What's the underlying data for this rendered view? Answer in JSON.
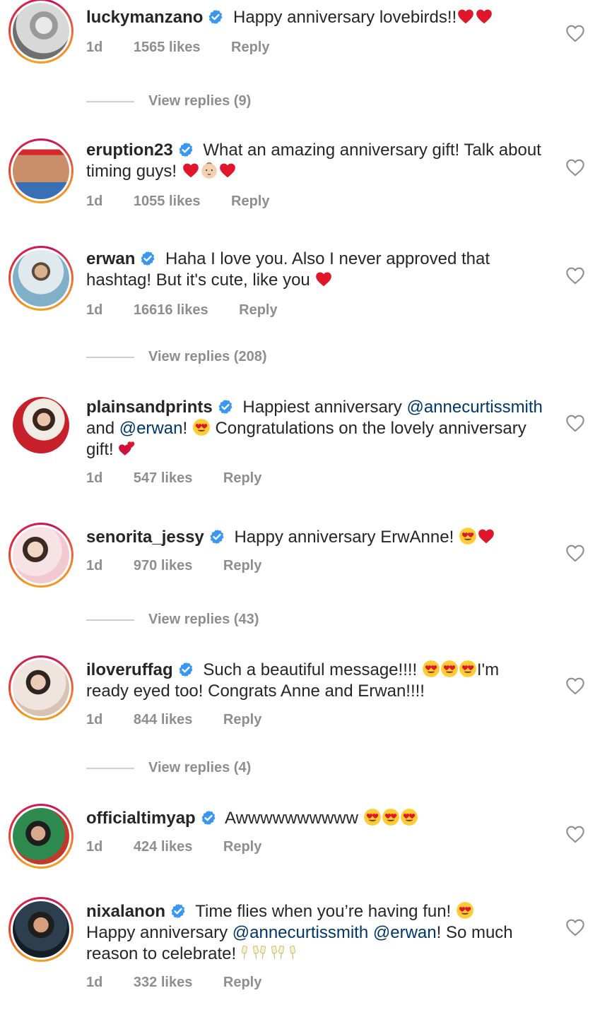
{
  "comments": [
    {
      "username": "luckymanzano",
      "text": " Happy anniversary lovebirds!!",
      "time": "1d",
      "likes": "1565 likes",
      "reply": "Reply",
      "view_replies": "View replies (9)"
    },
    {
      "username": "eruption23",
      "text": " What an amazing anniversary gift! Talk about timing guys! ",
      "time": "1d",
      "likes": "1055 likes",
      "reply": "Reply"
    },
    {
      "username": "erwan",
      "text": " Haha I love you. Also I never approved that hashtag! But it's cute, like you ",
      "time": "1d",
      "likes": "16616 likes",
      "reply": "Reply",
      "view_replies": "View replies (208)"
    },
    {
      "username": "plainsandprints",
      "text_a": " Happiest anniversary ",
      "mention1": "@annecurtissmith",
      "text_b": " and ",
      "mention2": "@erwan",
      "text_c": "! ",
      "text_d": " Congratulations on the lovely anniversary gift! ",
      "time": "1d",
      "likes": "547 likes",
      "reply": "Reply"
    },
    {
      "username": "senorita_jessy",
      "text": " Happy anniversary ErwAnne! ",
      "time": "1d",
      "likes": "970 likes",
      "reply": "Reply",
      "view_replies": "View replies (43)"
    },
    {
      "username": "iloveruffag",
      "text_a": " Such a beautiful message!!!! ",
      "text_b": "I'm ready eyed too! Congrats Anne and Erwan!!!!",
      "time": "1d",
      "likes": "844 likes",
      "reply": "Reply",
      "view_replies": "View replies (4)"
    },
    {
      "username": "officialtimyap",
      "text": " Awwwwwwwwww ",
      "time": "1d",
      "likes": "424 likes",
      "reply": "Reply"
    },
    {
      "username": "nixalanon",
      "text_a": " Time flies when you’re having fun! ",
      "text_b": "Happy anniversary ",
      "mention1": "@annecurtissmith",
      "text_c": " ",
      "mention2": "@erwan",
      "text_d": "! So much reason to celebrate! ",
      "time": "1d",
      "likes": "332 likes",
      "reply": "Reply"
    }
  ],
  "colors": {
    "text": "#262626",
    "meta": "#8e8e8e",
    "mention": "#00376b",
    "verified": "#3897f0",
    "heart": "#e0162b"
  },
  "icons": {
    "verified": "verified-badge-icon",
    "like": "heart-outline-icon",
    "emoji_heart": "red-heart-emoji",
    "emoji_eyes": "heart-eyes-emoji",
    "emoji_baby": "baby-emoji",
    "emoji_hearts": "two-hearts-emoji",
    "emoji_cheers": "clinking-glasses-emoji"
  }
}
